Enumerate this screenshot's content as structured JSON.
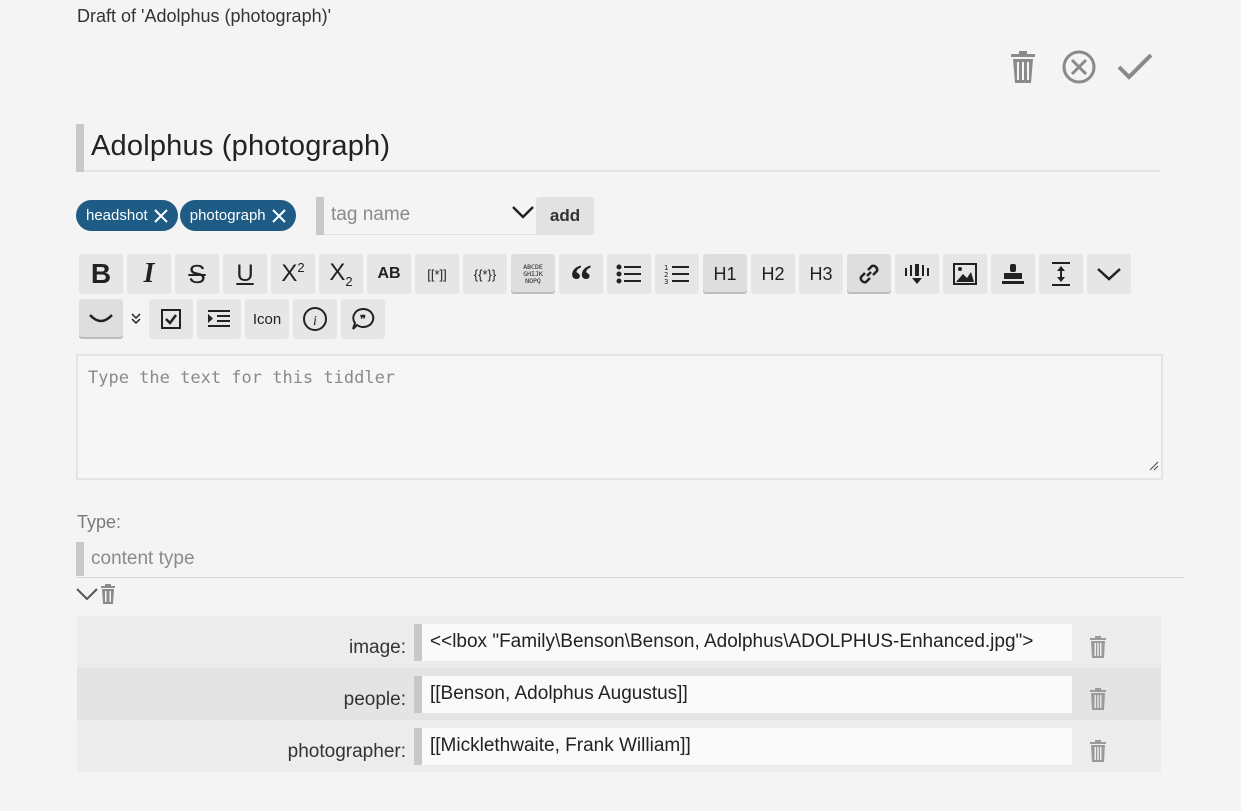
{
  "header": {
    "draft_title": "Draft of 'Adolphus (photograph)'",
    "controls": [
      {
        "name": "delete-icon",
        "label": "delete"
      },
      {
        "name": "cancel-icon",
        "label": "cancel"
      },
      {
        "name": "done-icon",
        "label": "done"
      }
    ]
  },
  "title": {
    "value": "Adolphus (photograph)"
  },
  "tags": {
    "items": [
      "headshot",
      "photograph"
    ],
    "tag_color": "#1e5b85",
    "new_tag_placeholder": "tag name",
    "add_label": "add"
  },
  "toolbar": {
    "row1": [
      {
        "name": "bold-button",
        "label": "B",
        "icon": "bold"
      },
      {
        "name": "italic-button",
        "label": "I",
        "icon": "italic"
      },
      {
        "name": "strikethrough-button",
        "label": "S",
        "icon": "strikethrough"
      },
      {
        "name": "underline-button",
        "label": "U",
        "icon": "underline"
      },
      {
        "name": "superscript-button",
        "label": "X²",
        "icon": "superscript"
      },
      {
        "name": "subscript-button",
        "label": "X₂",
        "icon": "subscript"
      },
      {
        "name": "smallcaps-button",
        "label": "AB",
        "icon": "smallcaps"
      },
      {
        "name": "transclude-button",
        "label": "[[*]]",
        "icon": "transclude"
      },
      {
        "name": "transclude-wikitext-button",
        "label": "{{*}}",
        "icon": "transclude-wikitext"
      },
      {
        "name": "monospace-button",
        "label": "ABCDE",
        "icon": "monospace"
      },
      {
        "name": "quote-button",
        "label": "❝",
        "icon": "quote"
      },
      {
        "name": "bullet-list-button",
        "label": "",
        "icon": "bullet-list"
      },
      {
        "name": "numbered-list-button",
        "label": "",
        "icon": "numbered-list"
      },
      {
        "name": "heading-1-button",
        "label": "H1",
        "icon": "heading-1"
      },
      {
        "name": "heading-2-button",
        "label": "H2",
        "icon": "heading-2"
      },
      {
        "name": "heading-3-button",
        "label": "H3",
        "icon": "heading-3"
      },
      {
        "name": "link-button",
        "label": "",
        "icon": "link"
      },
      {
        "name": "linkify-button",
        "label": "",
        "icon": "linkify"
      },
      {
        "name": "picture-button",
        "label": "",
        "icon": "picture"
      },
      {
        "name": "stamp-button",
        "label": "",
        "icon": "stamp"
      },
      {
        "name": "size-button",
        "label": "",
        "icon": "size"
      },
      {
        "name": "more-button",
        "label": "",
        "icon": "chevron-down"
      }
    ],
    "row2": [
      {
        "name": "emoji-button",
        "label": "",
        "icon": "smile"
      },
      {
        "name": "emoji-dropdown-button",
        "label": "",
        "icon": "double-chevron"
      },
      {
        "name": "checkbox-button",
        "label": "",
        "icon": "checkbox"
      },
      {
        "name": "indent-button",
        "label": "",
        "icon": "indent"
      },
      {
        "name": "icon-button",
        "label": "Icon",
        "icon": "text"
      },
      {
        "name": "info-button",
        "label": "",
        "icon": "info"
      },
      {
        "name": "comment-button",
        "label": "",
        "icon": "speech"
      }
    ]
  },
  "editor": {
    "placeholder": "Type the text for this tiddler"
  },
  "type": {
    "label": "Type:",
    "placeholder": "content type"
  },
  "fields": [
    {
      "label": "image:",
      "value": "<<lbox \"Family\\Benson\\Benson, Adolphus\\ADOLPHUS-Enhanced.jpg\">"
    },
    {
      "label": "people:",
      "value": "[[Benson, Adolphus Augustus]]"
    },
    {
      "label": "photographer:",
      "value": "[[Micklethwaite, Frank William]]"
    }
  ]
}
